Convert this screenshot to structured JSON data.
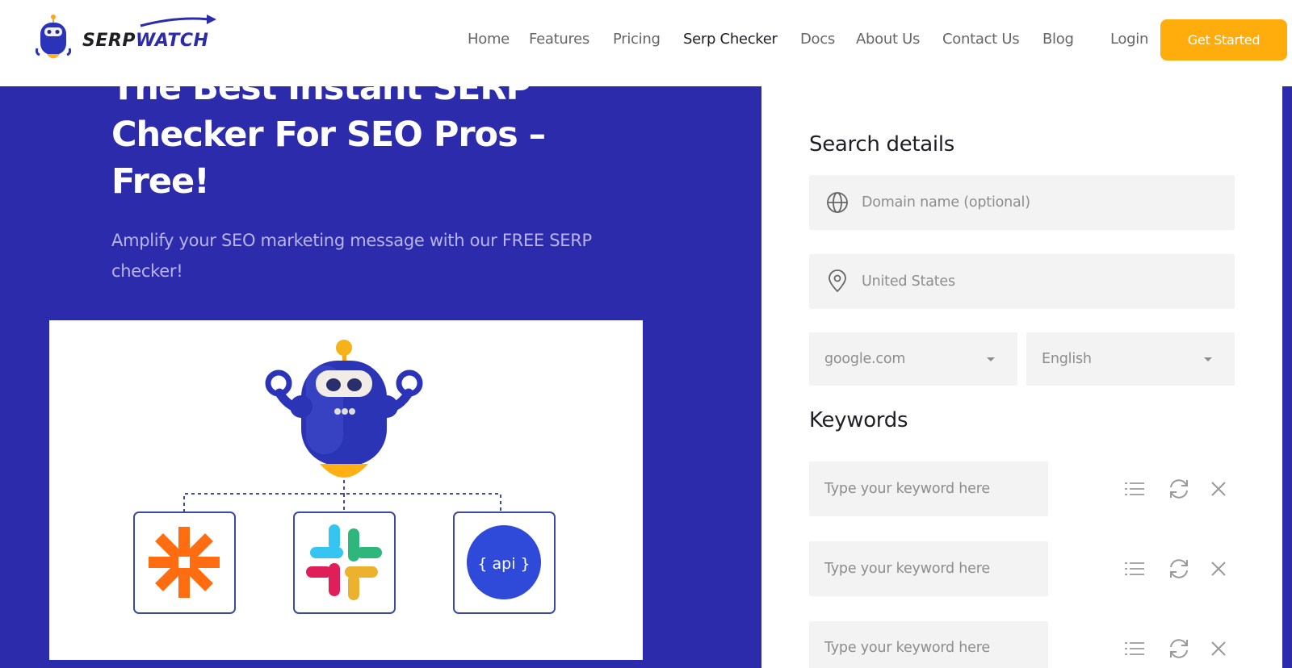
{
  "header": {
    "logo": {
      "part1": "SERP",
      "part2": "WATCH"
    },
    "nav": [
      {
        "label": "Home",
        "active": false
      },
      {
        "label": "Features",
        "active": false
      },
      {
        "label": "Pricing",
        "active": false
      },
      {
        "label": "Serp Checker",
        "active": true
      },
      {
        "label": "Docs",
        "active": false
      },
      {
        "label": "About Us",
        "active": false
      },
      {
        "label": "Contact Us",
        "active": false
      },
      {
        "label": "Blog",
        "active": false
      }
    ],
    "login": "Login",
    "cta": "Get Started"
  },
  "hero": {
    "title_line1": "The Best Instant SERP",
    "title_line2": "Checker For SEO Pros –",
    "title_line3": "Free!",
    "subtitle": "Amplify your SEO marketing message with our FREE SERP checker!",
    "illustration": {
      "api_label": "{ api }"
    }
  },
  "search": {
    "title": "Search details",
    "domain_placeholder": "Domain name (optional)",
    "location_value": "United States",
    "engine_value": "google.com",
    "language_value": "English"
  },
  "keywords": {
    "title": "Keywords",
    "rows": [
      {
        "placeholder": "Type your keyword here"
      },
      {
        "placeholder": "Type your keyword here"
      },
      {
        "placeholder": "Type your keyword here"
      }
    ]
  },
  "colors": {
    "brand": "#2b2bab",
    "accent": "#ffad0d",
    "field_bg": "#f3f3f3"
  },
  "icons": [
    "robot-logo-icon",
    "globe-icon",
    "location-pin-icon",
    "list-icon",
    "refresh-icon",
    "close-icon",
    "zapier-icon",
    "slack-icon",
    "api-icon"
  ]
}
